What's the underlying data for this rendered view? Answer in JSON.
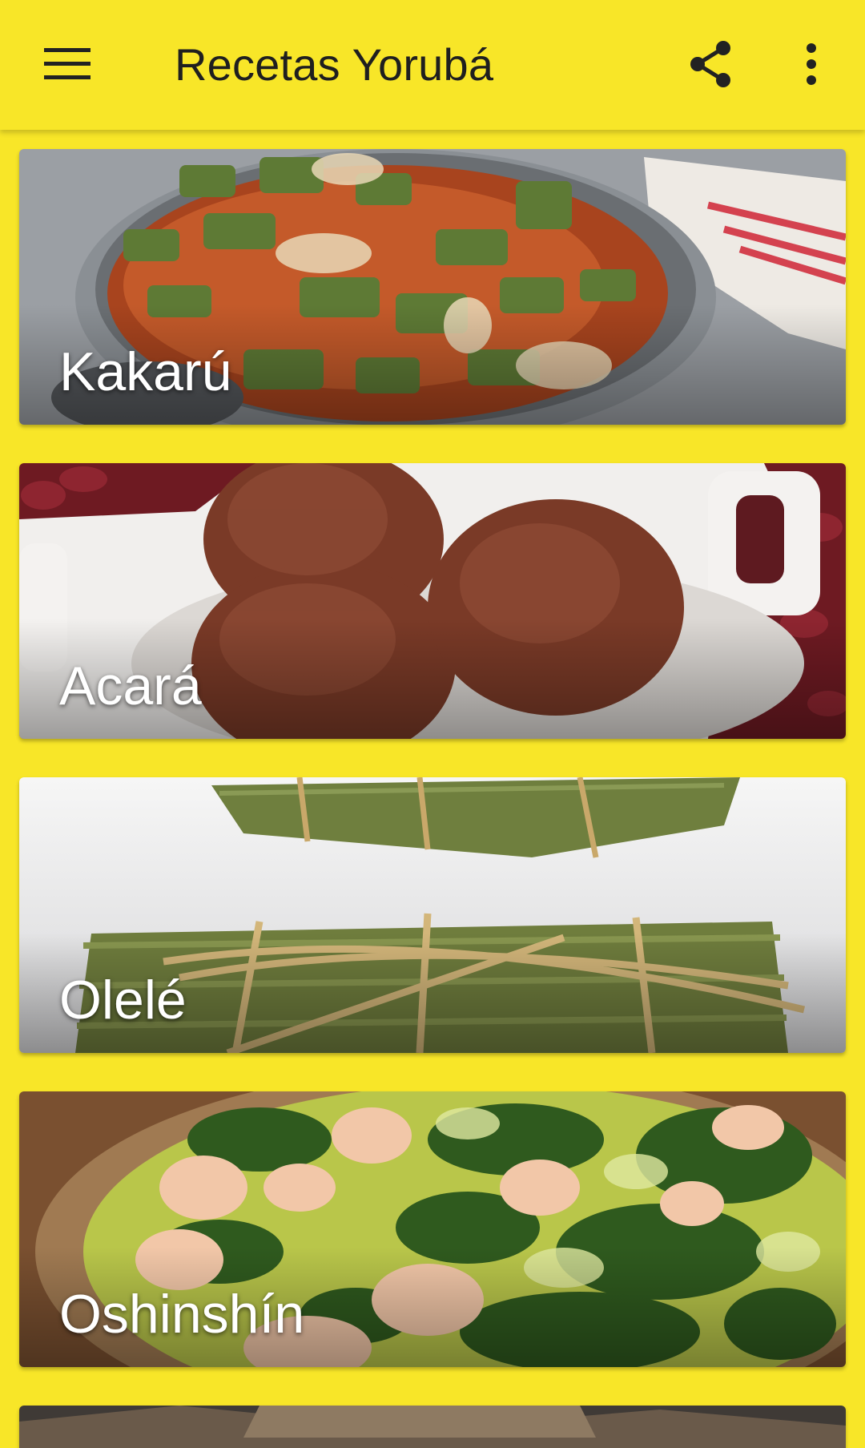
{
  "appbar": {
    "title": "Recetas Yorubá",
    "icons": {
      "menu": "menu-icon",
      "share": "share-icon",
      "more": "more-vert-icon"
    }
  },
  "colors": {
    "primary": "#f8e628",
    "title_text": "#1f1f1f",
    "card_label": "#ffffff"
  },
  "recipes": [
    {
      "name": "Kakarú"
    },
    {
      "name": "Acará"
    },
    {
      "name": "Olelé"
    },
    {
      "name": "Oshinshín"
    }
  ]
}
